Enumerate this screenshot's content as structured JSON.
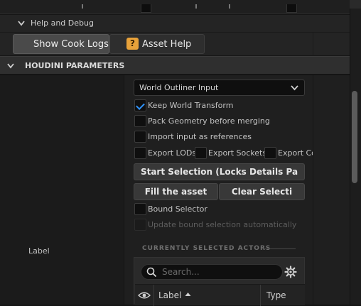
{
  "help_debug": {
    "title": "Help and Debug",
    "show_cook_logs": "Show Cook Logs",
    "asset_help": "Asset Help"
  },
  "houdini_parameters": {
    "title": "HOUDINI PARAMETERS",
    "label": "Label",
    "input_type": {
      "selected": "World Outliner Input"
    },
    "options": {
      "keep_world_transform": {
        "label": "Keep World Transform",
        "checked": true
      },
      "pack_geometry": {
        "label": "Pack Geometry before merging",
        "checked": false
      },
      "import_as_references": {
        "label": "Import input as references",
        "checked": false
      },
      "export_lods": {
        "label": "Export LODs",
        "checked": false
      },
      "export_sockets": {
        "label": "Export Sockets",
        "checked": false
      },
      "export_colliders": {
        "label": "Export Col",
        "checked": false
      }
    },
    "start_selection": "Start Selection (Locks Details Pa",
    "fill_asset": "Fill the asset",
    "clear_selection": "Clear Selecti",
    "bound_selector": {
      "label": "Bound Selector",
      "checked": false
    },
    "update_bound": {
      "label": "Update bound selection automatically",
      "checked": false,
      "disabled": true
    },
    "selected_actors": {
      "header": "CURRENTLY SELECTED ACTORS",
      "search_placeholder": "Search...",
      "columns": [
        "Label",
        "Type"
      ]
    }
  },
  "colors": {
    "accent": "#2f93ff",
    "asset_help_icon": "#e8a23a"
  }
}
